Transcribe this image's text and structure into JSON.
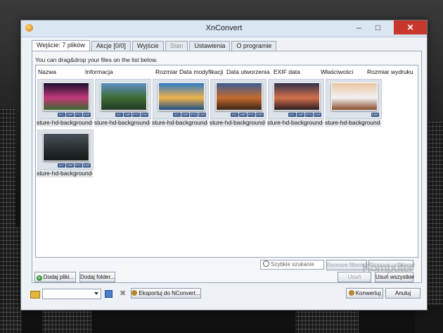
{
  "window": {
    "title": "XnConvert"
  },
  "tabs": [
    {
      "label": "Wejście: 7 plików",
      "active": true
    },
    {
      "label": "Akcje [0/0]"
    },
    {
      "label": "Wyjście"
    },
    {
      "label": "Stan",
      "disabled": true
    },
    {
      "label": "Ustawienia"
    },
    {
      "label": "O programie"
    }
  ],
  "hint": "You can drag&drop your files on the list below.",
  "columns": [
    "Nazwa",
    "Informacja",
    "Rozmiar",
    "Data modyfikacji",
    "Data utworzenia",
    "EXIF data",
    "Właściwości",
    "Rozmiar wydruku"
  ],
  "files": [
    {
      "name": "sture-hd-background-",
      "badges": [
        "ICC",
        "XMP",
        "IPTC",
        "EXIF"
      ],
      "colors": [
        "#1a1030",
        "#c2387a",
        "#3b6a2d"
      ]
    },
    {
      "name": "sture-hd-background-",
      "badges": [
        "ICC",
        "XMP",
        "IPTC",
        "EXIF"
      ],
      "colors": [
        "#5f8fc4",
        "#3f6a34",
        "#1f3b25"
      ]
    },
    {
      "name": "sture-hd-background-",
      "badges": [
        "ICC",
        "XMP",
        "IPTC",
        "EXIF"
      ],
      "colors": [
        "#2e78c6",
        "#f0b44a",
        "#1d4f86"
      ]
    },
    {
      "name": "sture-hd-background-",
      "badges": [
        "ICC",
        "XMP",
        "IPTC",
        "EXIF"
      ],
      "colors": [
        "#3a5e93",
        "#c56a2f",
        "#3b2415"
      ]
    },
    {
      "name": "sture-hd-background-",
      "badges": [
        "ICC",
        "XMP",
        "IPTC",
        "EXIF"
      ],
      "colors": [
        "#31324a",
        "#d4704a",
        "#291c22"
      ]
    },
    {
      "name": "sture-hd-background-",
      "badges": [
        "EXIF"
      ],
      "colors": [
        "#e9c8a2",
        "#f2f2f2",
        "#8a4b2a"
      ]
    },
    {
      "name": "sture-hd-background-",
      "badges": [
        "ICC",
        "XMP",
        "IPTC",
        "EXIF"
      ],
      "colors": [
        "#48505a",
        "#2a3032",
        "#13181a"
      ]
    }
  ],
  "search": {
    "placeholder": "Szybkie szukanie"
  },
  "buttons": {
    "remove_filtered": "Remove filtered",
    "remove_unfiltered": "Remove unfiltered",
    "remove": "Usuń",
    "remove_all": "Usuń wszystkie",
    "add_files": "Dodaj pliki...",
    "add_folder": "Dodaj folder...",
    "export": "Eksportuj do NConvert...",
    "convert": "Konwertuj",
    "cancel": "Anuluj"
  },
  "watermark": "Komputer"
}
